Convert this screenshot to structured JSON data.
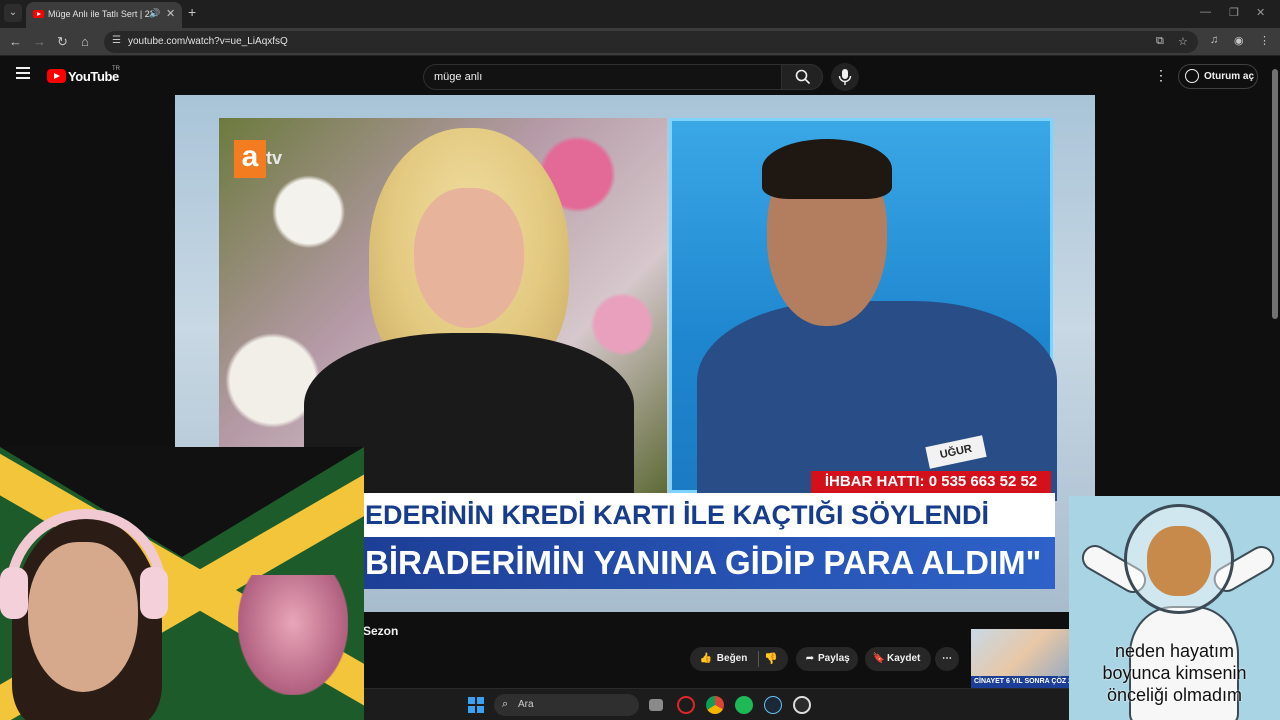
{
  "browser": {
    "tab_title": "Müge Anlı ile Tatlı Sert | 22",
    "url": "youtube.com/watch?v=ue_LiAqxfsQ"
  },
  "youtube": {
    "logo_text": "YouTube",
    "country_code": "TR",
    "search_value": "müge anlı",
    "signin_label": "Oturum aç"
  },
  "video": {
    "channel_logo": "atv",
    "hotline": "İHBAR HATTI: 0 535 663 52 52",
    "banner_line1": "EDERİNİN KREDİ KARTI İLE KAÇTIĞI SÖYLENDİ",
    "banner_line2": "BİRADERİMİN YANINA GİDİP PARA ALDIM\"",
    "name_tag": "UĞUR",
    "title_fragment": "Sezon"
  },
  "actions": {
    "like": "Beğen",
    "share": "Paylaş",
    "save": "Kaydet"
  },
  "recommended": {
    "caption": "CİNAYET 6 YIL SONRA ÇÖZ 21:"
  },
  "overlay": {
    "caption_lines": [
      "neden hayatım",
      "boyunca kimsenin",
      "önceliği olmadım"
    ]
  },
  "taskbar": {
    "search_placeholder": "Ara"
  },
  "colors": {
    "youtube_red": "#ff0000",
    "atv_orange": "#f47c20",
    "hotline_red": "#d4101a",
    "banner_blue": "#1d3e96"
  }
}
